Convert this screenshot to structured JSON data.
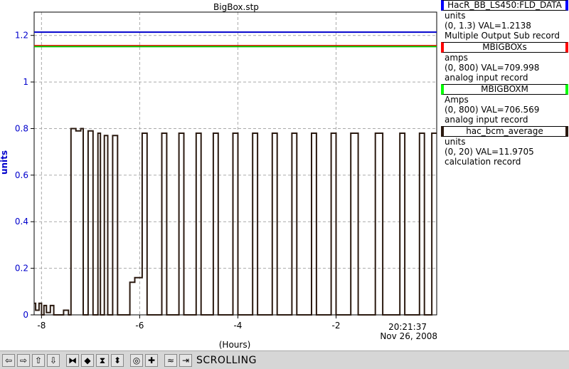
{
  "chart_data": {
    "type": "line",
    "title": "BigBox.stp",
    "ylabel": "units",
    "xlabel": "(Hours)",
    "xlim": [
      -8.15,
      0.05
    ],
    "ylim": [
      0,
      1.3
    ],
    "x_ticks": [
      -8,
      -6,
      -4,
      -2
    ],
    "x_tick_labels": [
      "-8",
      "-6",
      "-4",
      "-2"
    ],
    "y_ticks": [
      0,
      0.2,
      0.4,
      0.6,
      0.8,
      1,
      1.2
    ],
    "y_tick_labels": [
      "0",
      "0.2",
      "0.4",
      "0.6",
      "0.8",
      "1",
      "1.2"
    ],
    "time_label": "20:21:37",
    "date_label": "Nov 26, 2008",
    "grid": true,
    "series": [
      {
        "name": "HacR_BB_LS450:FLD_DATA",
        "color": "#0000cc",
        "x": [
          -8.15,
          0.05
        ],
        "y": [
          1.214,
          1.214
        ]
      },
      {
        "name": "MBIGBOXs",
        "color": "#ff0000",
        "x": [
          -8.15,
          0.05
        ],
        "y": [
          1.156,
          1.156
        ]
      },
      {
        "name": "MBIGBOXM",
        "color": "#00cc00",
        "x": [
          -8.15,
          0.05
        ],
        "y": [
          1.152,
          1.152
        ]
      },
      {
        "name": "hac_bcm_average",
        "color": "#2b1a10",
        "x": [
          -8.15,
          -8.12,
          -8.12,
          -8.05,
          -8.05,
          -8.0,
          -8.0,
          -7.95,
          -7.95,
          -7.9,
          -7.9,
          -7.82,
          -7.82,
          -7.75,
          -7.75,
          -7.65,
          -7.65,
          -7.55,
          -7.55,
          -7.45,
          -7.45,
          -7.4,
          -7.4,
          -7.3,
          -7.3,
          -7.2,
          -7.2,
          -7.15,
          -7.15,
          -7.05,
          -7.05,
          -6.95,
          -6.95,
          -6.85,
          -6.85,
          -6.8,
          -6.8,
          -6.72,
          -6.72,
          -6.65,
          -6.65,
          -6.55,
          -6.55,
          -6.45,
          -6.45,
          -6.2,
          -6.2,
          -6.15,
          -6.15,
          -6.1,
          -6.1,
          -5.95,
          -5.95,
          -5.85,
          -5.85,
          -5.55,
          -5.55,
          -5.45,
          -5.45,
          -5.2,
          -5.2,
          -5.1,
          -5.1,
          -4.85,
          -4.85,
          -4.75,
          -4.75,
          -4.5,
          -4.5,
          -4.4,
          -4.4,
          -4.1,
          -4.1,
          -4.0,
          -4.0,
          -3.7,
          -3.7,
          -3.6,
          -3.6,
          -3.3,
          -3.3,
          -3.2,
          -3.2,
          -2.9,
          -2.9,
          -2.8,
          -2.8,
          -2.5,
          -2.5,
          -2.4,
          -2.4,
          -2.1,
          -2.1,
          -2.0,
          -2.0,
          -1.7,
          -1.7,
          -1.55,
          -1.55,
          -1.2,
          -1.2,
          -1.05,
          -1.05,
          -0.7,
          -0.7,
          -0.6,
          -0.6,
          -0.3,
          -0.3,
          -0.2,
          -0.2,
          -0.05,
          -0.05,
          0.05
        ],
        "y": [
          0.05,
          0.05,
          0.02,
          0.02,
          0.05,
          0.05,
          0.0,
          0.0,
          0.04,
          0.04,
          0.01,
          0.01,
          0.04,
          0.04,
          0.0,
          0.0,
          0.0,
          0.0,
          0.02,
          0.02,
          0.0,
          0.0,
          0.8,
          0.8,
          0.79,
          0.79,
          0.8,
          0.8,
          0.0,
          0.0,
          0.79,
          0.79,
          0.0,
          0.0,
          0.78,
          0.78,
          0.0,
          0.0,
          0.77,
          0.77,
          0.0,
          0.0,
          0.77,
          0.77,
          0.0,
          0.0,
          0.14,
          0.14,
          0.14,
          0.14,
          0.16,
          0.16,
          0.78,
          0.78,
          0.0,
          0.0,
          0.78,
          0.78,
          0.0,
          0.0,
          0.78,
          0.78,
          0.0,
          0.0,
          0.78,
          0.78,
          0.0,
          0.0,
          0.78,
          0.78,
          0.0,
          0.0,
          0.78,
          0.78,
          0.0,
          0.0,
          0.78,
          0.78,
          0.0,
          0.0,
          0.78,
          0.78,
          0.0,
          0.0,
          0.78,
          0.78,
          0.0,
          0.0,
          0.78,
          0.78,
          0.0,
          0.0,
          0.78,
          0.78,
          0.0,
          0.0,
          0.78,
          0.78,
          0.0,
          0.0,
          0.78,
          0.78,
          0.0,
          0.0,
          0.78,
          0.78,
          0.0,
          0.0,
          0.78,
          0.78,
          0.0,
          0.0,
          0.78,
          0.78
        ]
      }
    ]
  },
  "legend": [
    {
      "name": "HacR_BB_LS450:FLD_DATA",
      "color": "#0000ff",
      "units": "units",
      "range_val": "(0, 1.3) VAL=1.2138",
      "record": "Multiple Output Sub record"
    },
    {
      "name": "MBIGBOXs",
      "color": "#ff0000",
      "units": "amps",
      "range_val": "(0, 800) VAL=709.998",
      "record": "analog input record"
    },
    {
      "name": "MBIGBOXM",
      "color": "#00ff00",
      "units": "Amps",
      "range_val": "(0, 800) VAL=706.569",
      "record": "analog input record"
    },
    {
      "name": "hac_bcm_average",
      "color": "#2b1a10",
      "units": "units",
      "range_val": "(0, 20) VAL=11.9705",
      "record": "calculation record"
    }
  ],
  "toolbar": {
    "buttons": [
      {
        "name": "scroll-left-icon",
        "glyph": "⇦"
      },
      {
        "name": "scroll-right-icon",
        "glyph": "⇨"
      },
      {
        "name": "scroll-up-icon",
        "glyph": "⇧"
      },
      {
        "name": "scroll-down-icon",
        "glyph": "⇩"
      },
      {
        "name": "zoom-in-x-icon",
        "glyph": "⧓"
      },
      {
        "name": "zoom-out-x-icon",
        "glyph": "◆"
      },
      {
        "name": "zoom-in-y-icon",
        "glyph": "⧗"
      },
      {
        "name": "zoom-out-y-icon",
        "glyph": "⬍"
      },
      {
        "name": "autoscale-icon",
        "glyph": "◎"
      },
      {
        "name": "add-point-icon",
        "glyph": "✚"
      },
      {
        "name": "stagger-icon",
        "glyph": "≈"
      },
      {
        "name": "export-icon",
        "glyph": "⇥"
      }
    ],
    "mode": "SCROLLING"
  }
}
